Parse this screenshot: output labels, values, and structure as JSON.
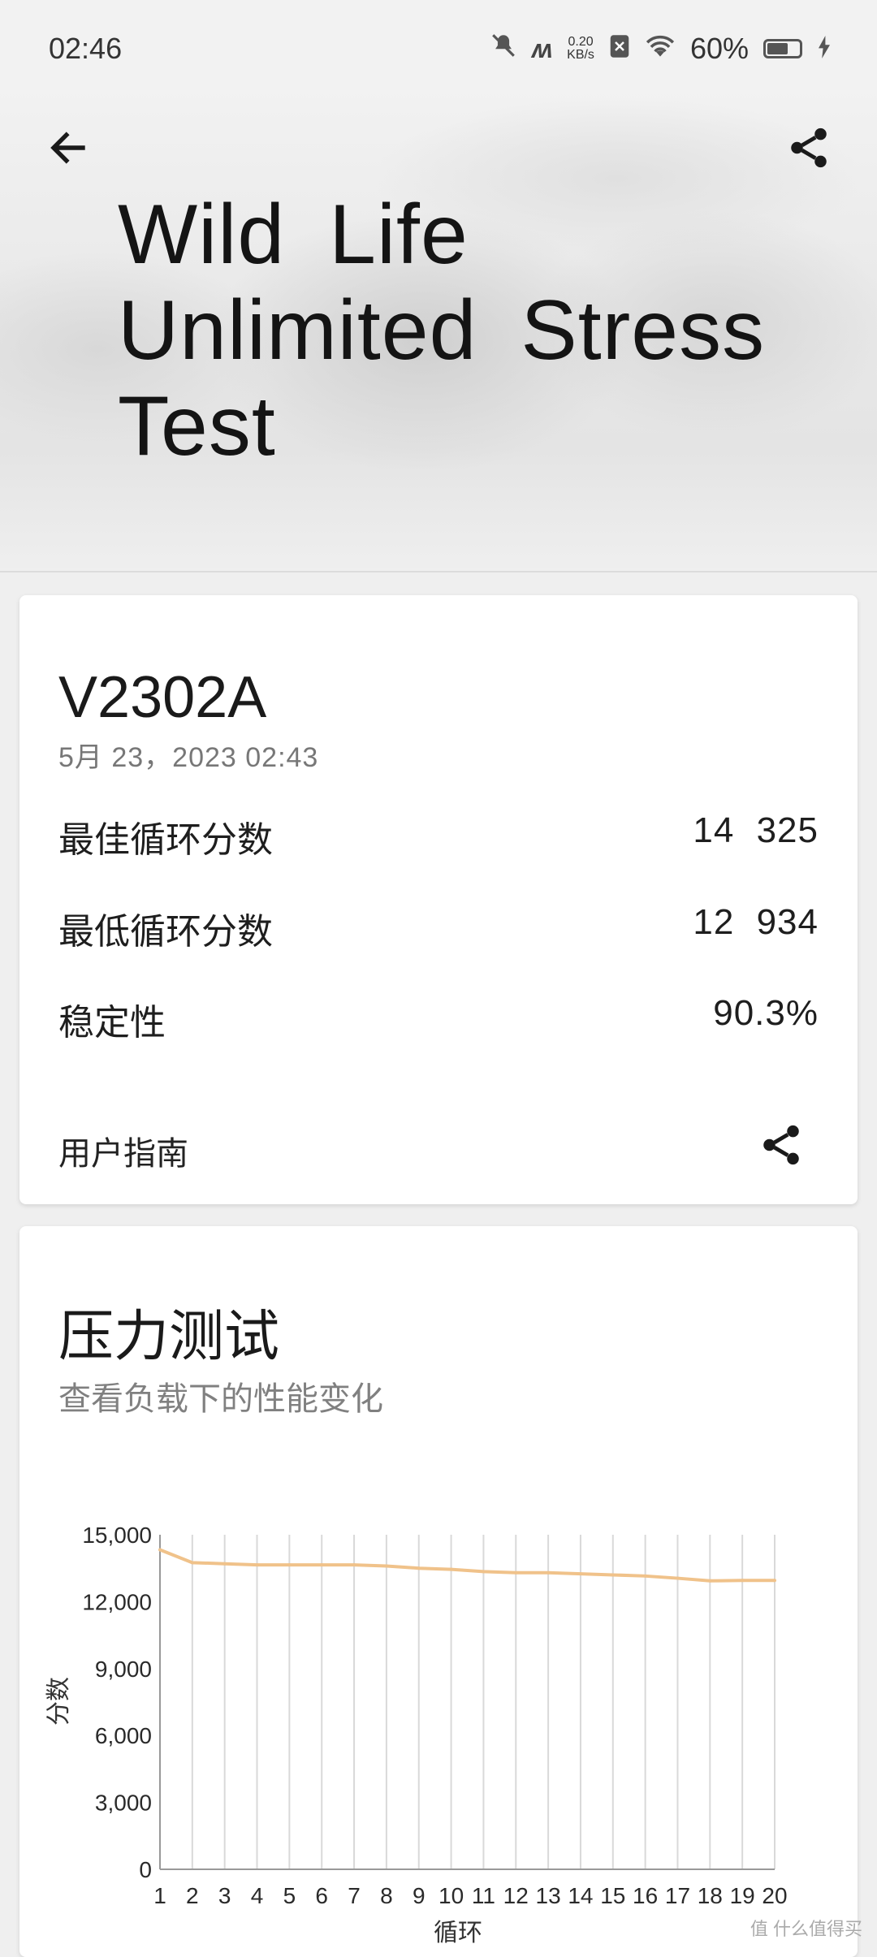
{
  "status_bar": {
    "time": "02:46",
    "net_speed_value": "0.20",
    "net_speed_unit": "KB/s",
    "battery": "60%"
  },
  "header": {
    "title": "Wild Life Unlimited Stress Test",
    "back_icon": "arrow-left-icon",
    "share_icon": "share-icon"
  },
  "result": {
    "device": "V2302A",
    "date": "5月 23，2023 02:43",
    "rows": [
      {
        "label": "最佳循环分数",
        "value": "14 325"
      },
      {
        "label": "最低循环分数",
        "value": "12 934"
      },
      {
        "label": "稳定性",
        "value": "90.3%"
      }
    ],
    "guide": "用户指南"
  },
  "stress": {
    "title": "压力测试",
    "subtitle": "查看负载下的性能变化"
  },
  "chart_data": {
    "type": "line",
    "ylabel": "分数",
    "xlabel": "循环",
    "ylim": [
      0,
      15000
    ],
    "yticks": [
      "15,000",
      "12,000",
      "9,000",
      "6,000",
      "3,000",
      "0"
    ],
    "yticks_values": [
      15000,
      12000,
      9000,
      6000,
      3000,
      0
    ],
    "categories": [
      "1",
      "2",
      "3",
      "4",
      "5",
      "6",
      "7",
      "8",
      "9",
      "10",
      "11",
      "12",
      "13",
      "14",
      "15",
      "16",
      "17",
      "18",
      "19",
      "20"
    ],
    "values": [
      14325,
      13750,
      13700,
      13650,
      13650,
      13650,
      13650,
      13600,
      13500,
      13450,
      13350,
      13300,
      13300,
      13250,
      13200,
      13150,
      13050,
      12934,
      12950,
      12950
    ],
    "line_color": "#f0c28a",
    "grid": "vertical"
  },
  "watermark": "值 什么值得买"
}
